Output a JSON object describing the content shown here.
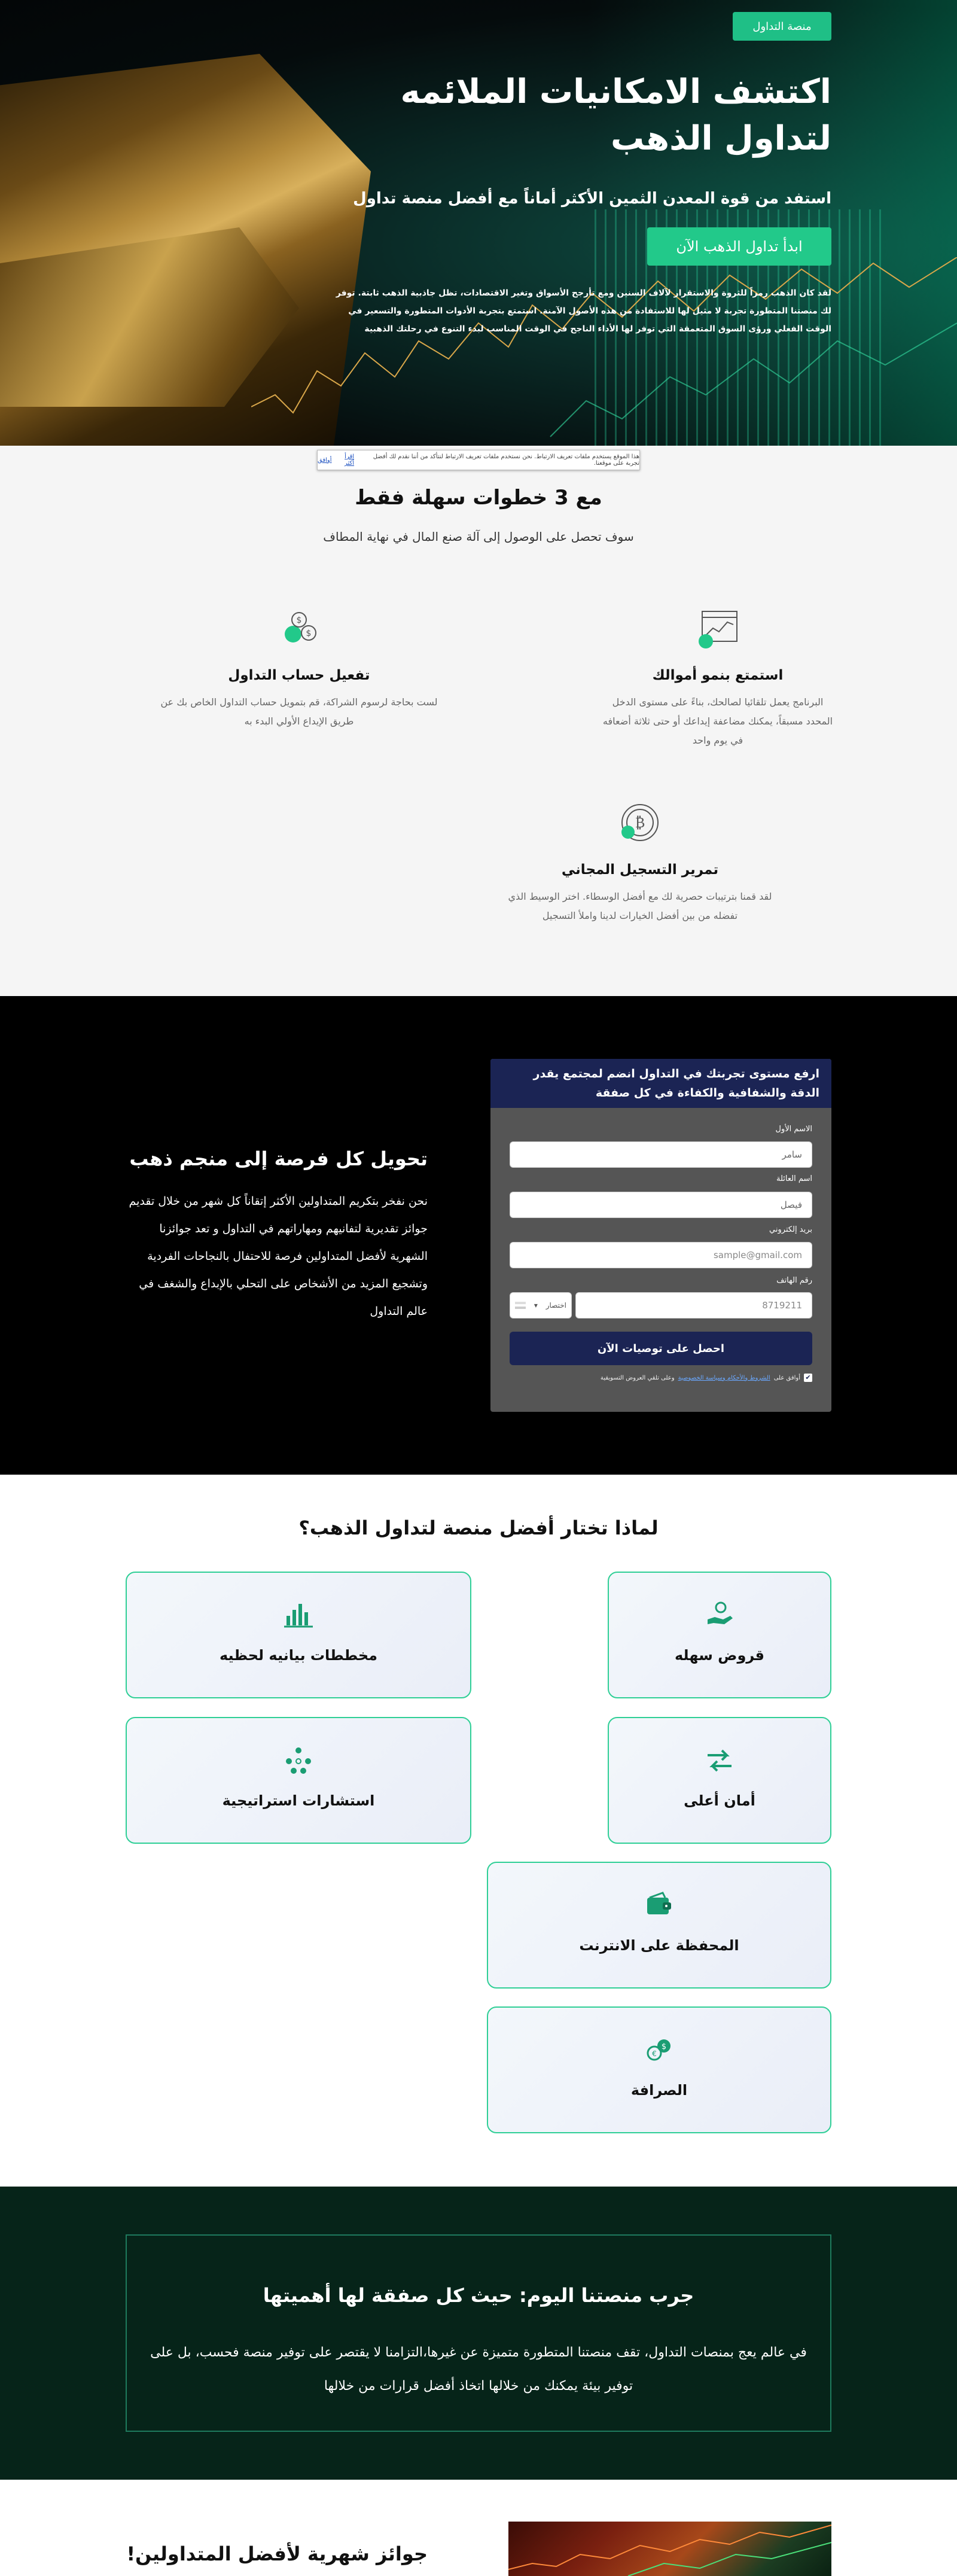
{
  "hero": {
    "badge": "منصة التداول",
    "title": "اكتشف الامكانيات الملائمه لتداول الذهب",
    "subtitle": "استفد من قوة المعدن الثمين الأكثر أماناً مع أفضل منصة تداول",
    "cta": "ابدأ تداول الذهب الآن",
    "description": "لقد كان الذهب رمزاً للثروة والاستقرار لآلاف السنين ومع تأرجح الأسواق وتغير الاقتصادات، تظل جاذبية الذهب ثابتة. توفر لك منصتنا المتطورة تجربة لا مثيل لها للاستفادة من هذه الأصول الآمنة. استمتع بتجربة الأدوات المتطورة والتسعير في الوقت الفعلي ورؤى السوق المتعمقة التي توفر لها الأداء الناجح في الوقت المناسب لبدء التنوع في رحلتك الذهبية"
  },
  "cookie": {
    "text": "هذا الموقع يستخدم ملفات تعريف الارتباط. نحن نستخدم ملفات تعريف الارتباط لنتأكد من أننا نقدم لك أفضل تجربة على موقعنا.",
    "link": "اقرأ أكثر",
    "accept": "أوافق"
  },
  "steps": {
    "title": "مع 3 خطوات سهلة فقط",
    "subtitle": "سوف تحصل على الوصول إلى آلة صنع المال في نهاية المطاف",
    "items": [
      {
        "title": "استمتع بنمو أموالك",
        "text": "البرنامج يعمل تلقائيا لصالحك، بناءً على مستوى الدخل المحدد مسبقاً، يمكنك مضاعفة إيداعك أو حتى ثلاثة أضعافه في يوم واحد"
      },
      {
        "title": "تفعيل حساب التداول",
        "text": "لست بحاجة لرسوم الشراكة، قم بتمويل حساب التداول الخاص بك عن طريق الإيداع الأولي البدء به"
      },
      {
        "title": "تمرير التسجيل المجاني",
        "text": "لقد قمنا بترتيبات حصرية لك مع أفضل الوسطاء. اختر الوسيط الذي تفضله من بين أفضل الخيارات لدينا واملأ التسجيل"
      }
    ]
  },
  "lead": {
    "heading": "تحويل كل فرصة إلى منجم ذهب",
    "paragraph": "نحن نفخر بتكريم المتداولين الأكثر إتقاناً كل شهر من خلال تقديم جوائز تقديرية لتفانيهم ومهاراتهم في التداول و تعد جوائزنا الشهرية لأفضل المتداولين فرصة للاحتفال بالنجاحات الفردية وتشجيع المزيد من الأشخاص على التحلي بالإبداع والشغف في عالم التداول",
    "form": {
      "header": "ارفع مستوى تجربتك في التداول انضم لمجتمع يقدر الدقة والشفافية والكفاءة في كل صفقة",
      "first_name_label": "الاسم الأول",
      "first_name_value": "سامر",
      "last_name_label": "اسم العائلة",
      "last_name_value": "فيصل",
      "email_label": "بريد إلكتروني",
      "email_placeholder": "sample@gmail.com",
      "phone_label": "رقم الهاتف",
      "phone_placeholder": "8719211",
      "country_select": "اختصار",
      "submit": "احصل على توصيات الآن",
      "consent_prefix": "أوافق على",
      "consent_link": "الشروط والأحكام وسياسة الخصوصية",
      "consent_suffix": "وعلى تلقي العروض التسويقية"
    }
  },
  "why": {
    "title": "لماذا تختار أفضل منصة لتداول الذهب؟",
    "features": [
      {
        "icon": "hand-coin-icon",
        "label": "قروض سهله"
      },
      {
        "icon": "bar-chart-icon",
        "label": "مخططات بيانيه لحظيه"
      },
      {
        "icon": "exchange-arrows-icon",
        "label": "أمان أعلى"
      },
      {
        "icon": "network-people-icon",
        "label": "استشارات استراتيجية"
      },
      {
        "icon": "wallet-icon",
        "label": "المحفظة على الانترنت"
      },
      {
        "icon": "currency-exchange-icon",
        "label": "الصرافة"
      }
    ]
  },
  "try": {
    "heading": "جرب منصتنا اليوم: حيث كل صفقة لها أهميتها",
    "paragraph": "في عالم يعج بمنصات التداول، تقف منصتنا المتطورة متميزة عن غيرها،التزامنا لا يقتصر على توفير منصة فحسب، بل على توفير بيئة يمكنك من خلالها اتخاذ أفضل قرارات من خلالها"
  },
  "awards": {
    "heading": "جوائز شهرية لأفضل المتداولين!"
  },
  "colors": {
    "accent": "#22c98a",
    "navy": "#1b2454",
    "dark_green": "#062419"
  }
}
